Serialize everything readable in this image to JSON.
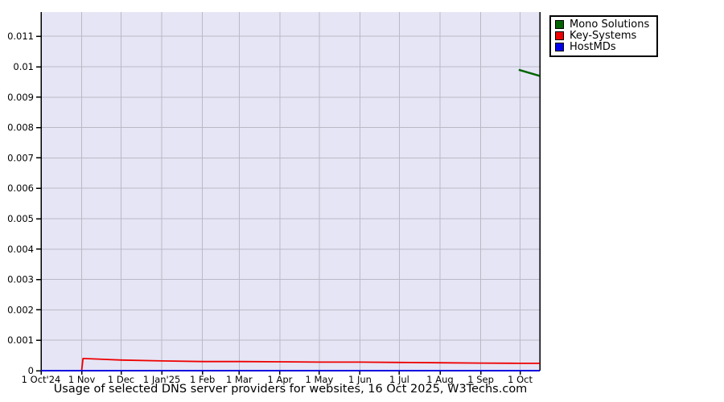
{
  "chart_data": {
    "type": "line",
    "title": "Usage of selected DNS server providers for websites, 16 Oct 2025, W3Techs.com",
    "legend_position": "top-right",
    "grid": true,
    "plot_colors": {
      "background": "#e5e5f5",
      "grid": "#b9b9c6",
      "axis": "#000000"
    },
    "x_axis": {
      "range_days": [
        0,
        380
      ],
      "ticks": [
        {
          "label": "1 Oct'24",
          "day": 0
        },
        {
          "label": "1 Nov",
          "day": 31
        },
        {
          "label": "1 Dec",
          "day": 61
        },
        {
          "label": "1 Jan'25",
          "day": 92
        },
        {
          "label": "1 Feb",
          "day": 123
        },
        {
          "label": "1 Mar",
          "day": 151
        },
        {
          "label": "1 Apr",
          "day": 182
        },
        {
          "label": "1 May",
          "day": 212
        },
        {
          "label": "1 Jun",
          "day": 243
        },
        {
          "label": "1 Jul",
          "day": 273
        },
        {
          "label": "1 Aug",
          "day": 304
        },
        {
          "label": "1 Sep",
          "day": 335
        },
        {
          "label": "1 Oct",
          "day": 365
        }
      ]
    },
    "y_axis": {
      "range": [
        0,
        0.0118
      ],
      "grid_step": 0.001,
      "ticks": [
        {
          "label": "0",
          "value": 0
        },
        {
          "label": "0.001",
          "value": 0.001
        },
        {
          "label": "0.002",
          "value": 0.002
        },
        {
          "label": "0.003",
          "value": 0.003
        },
        {
          "label": "0.004",
          "value": 0.004
        },
        {
          "label": "0.005",
          "value": 0.005
        },
        {
          "label": "0.006",
          "value": 0.006
        },
        {
          "label": "0.007",
          "value": 0.007
        },
        {
          "label": "0.008",
          "value": 0.008
        },
        {
          "label": "0.009",
          "value": 0.009
        },
        {
          "label": "0.01",
          "value": 0.01
        },
        {
          "label": "0.011",
          "value": 0.011
        }
      ]
    },
    "series": [
      {
        "name": "Mono Solutions",
        "color": "#006400",
        "width": 2.5,
        "points": [
          [
            364,
            0.0099
          ],
          [
            380,
            0.0097
          ]
        ]
      },
      {
        "name": "Key-Systems",
        "color": "#ee0000",
        "width": 1.8,
        "points": [
          [
            31,
            2e-05
          ],
          [
            32,
            0.0004
          ],
          [
            61,
            0.00035
          ],
          [
            92,
            0.00032
          ],
          [
            123,
            0.0003
          ],
          [
            151,
            0.0003
          ],
          [
            182,
            0.00029
          ],
          [
            212,
            0.00028
          ],
          [
            243,
            0.00028
          ],
          [
            273,
            0.00027
          ],
          [
            304,
            0.00026
          ],
          [
            335,
            0.00025
          ],
          [
            365,
            0.00024
          ],
          [
            380,
            0.00024
          ]
        ]
      },
      {
        "name": "HostMDs",
        "color": "#0000ee",
        "width": 1.8,
        "points": [
          [
            0,
            0
          ],
          [
            380,
            0
          ]
        ]
      }
    ]
  }
}
